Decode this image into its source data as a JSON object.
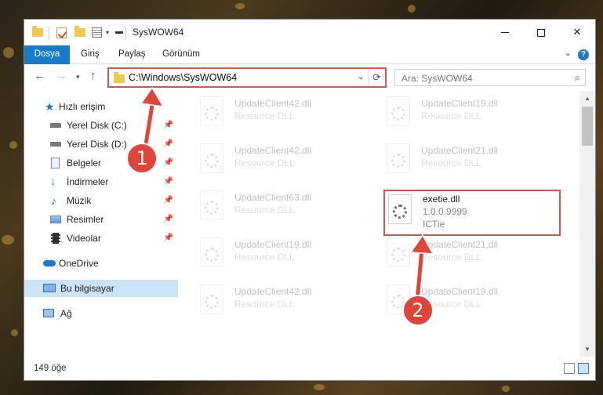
{
  "window": {
    "title": "SysWOW64",
    "controls": {
      "minimize": "",
      "maximize": "",
      "close": "✕"
    }
  },
  "ribbon": {
    "tabs": [
      {
        "label": "Dosya"
      },
      {
        "label": "Giriş"
      },
      {
        "label": "Paylaş"
      },
      {
        "label": "Görünüm"
      }
    ],
    "accent_color": "#1979ca",
    "help_label": "?"
  },
  "address": {
    "path": "C:\\Windows\\SysWOW64",
    "search_placeholder": "Ara: SysWOW64"
  },
  "navpane": {
    "quick_access": "Hızlı erişim",
    "items": [
      {
        "label": "Yerel Disk (C:)",
        "icon": "drive-icon",
        "pinned": true
      },
      {
        "label": "Yerel Disk (D:)",
        "icon": "drive-icon",
        "pinned": true
      },
      {
        "label": "Belgeler",
        "icon": "documents-icon",
        "pinned": true
      },
      {
        "label": "İndirmeler",
        "icon": "download-icon",
        "pinned": true
      },
      {
        "label": "Müzik",
        "icon": "music-icon",
        "pinned": true
      },
      {
        "label": "Resimler",
        "icon": "pictures-icon",
        "pinned": true
      },
      {
        "label": "Videolar",
        "icon": "videos-icon",
        "pinned": true
      }
    ],
    "onedrive": "OneDrive",
    "this_pc": "Bu bilgisayar",
    "network": "Ağ"
  },
  "files": [
    {
      "name": "UpdateClient42.dll",
      "desc": "Resource DLL"
    },
    {
      "name": "UpdateClient19.dll",
      "desc": "Resource DLL"
    },
    {
      "name": "UpdateClient42.dll",
      "desc": "Resource DLL"
    },
    {
      "name": "UpdateClient21.dll",
      "desc": "Resource DLL"
    },
    {
      "name": "UpdateClient63.dll",
      "desc": "Resource DLL"
    },
    {
      "name": "exetie.dll",
      "version": "1.0.0.9999",
      "company": "ICTie"
    },
    {
      "name": "UpdateClient19.dll",
      "desc": "Resource DLL"
    },
    {
      "name": "UpdateClient21.dll",
      "desc": "Resource DLL"
    },
    {
      "name": "UpdateClient42.dll",
      "desc": "Resource DLL"
    },
    {
      "name": "UpdateClient19.dll",
      "desc": "Resource DLL"
    }
  ],
  "status": {
    "item_count": "149 öğe"
  },
  "annotations": {
    "step1": "1",
    "step2": "2",
    "highlight_color": "#d9534f"
  }
}
